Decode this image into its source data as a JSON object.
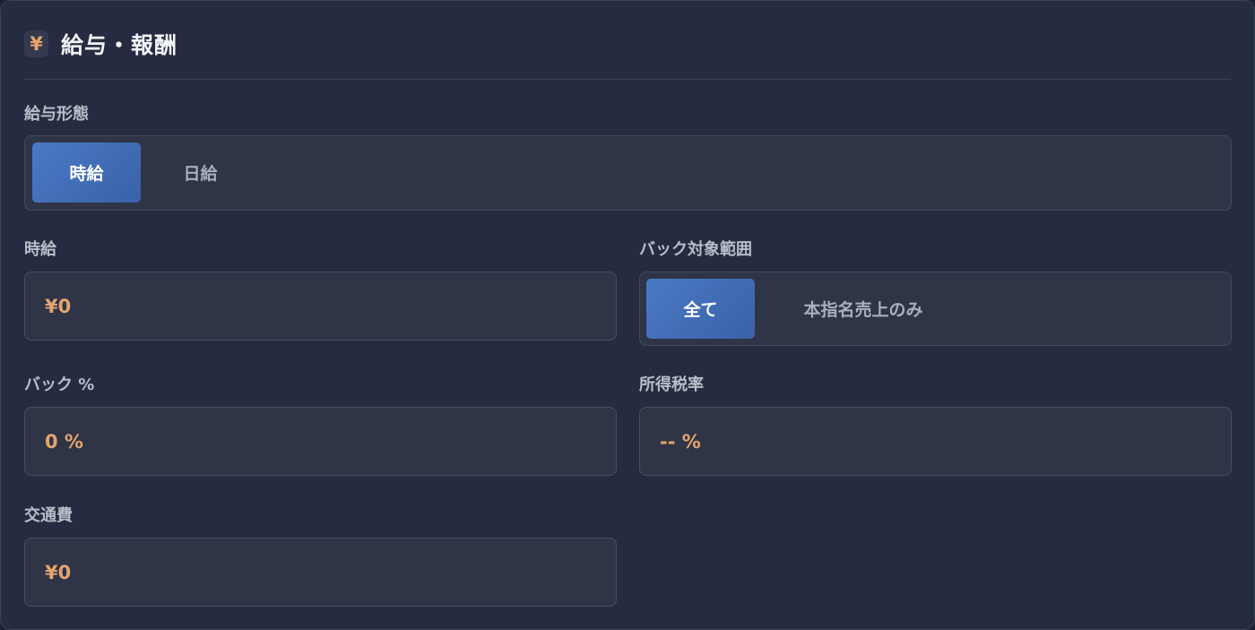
{
  "section": {
    "icon": "yen-icon",
    "icon_glyph": "¥",
    "title": "給与・報酬"
  },
  "pay_type": {
    "label": "給与形態",
    "options": [
      "時給",
      "日給"
    ],
    "selected": "時給"
  },
  "hourly_wage": {
    "label": "時給",
    "value": "¥0"
  },
  "back_scope": {
    "label": "バック対象範囲",
    "options": [
      "全て",
      "本指名売上のみ"
    ],
    "selected": "全て"
  },
  "back_percent": {
    "label": "バック %",
    "value": "0 %"
  },
  "income_tax": {
    "label": "所得税率",
    "value": "-- %"
  },
  "transport": {
    "label": "交通費",
    "value": "¥0"
  },
  "colors": {
    "accent": "#4a79c4",
    "value_text": "#e2a56e",
    "card_bg": "#252c41"
  }
}
